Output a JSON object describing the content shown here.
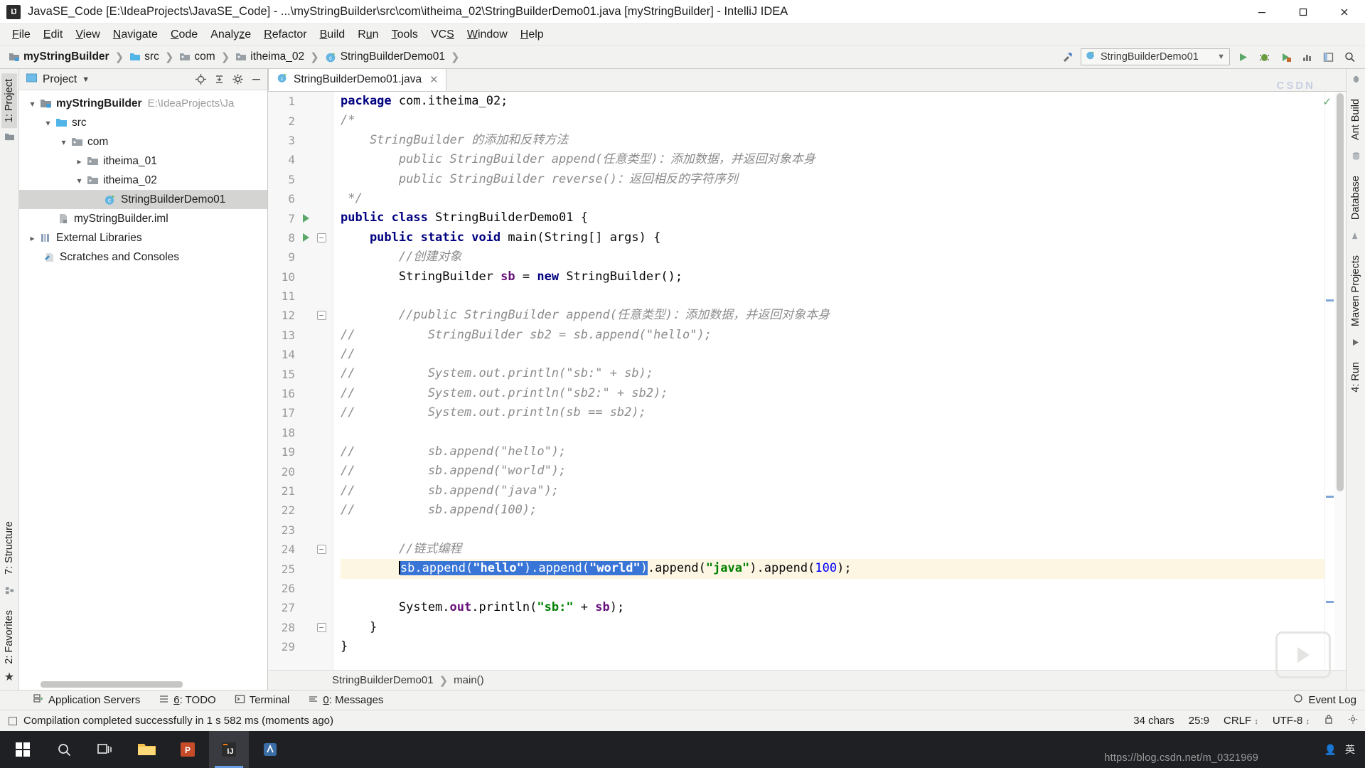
{
  "window": {
    "title": "JavaSE_Code [E:\\IdeaProjects\\JavaSE_Code] - ...\\myStringBuilder\\src\\com\\itheima_02\\StringBuilderDemo01.java [myStringBuilder] - IntelliJ IDEA",
    "app_icon": "IJ",
    "controls": {
      "minimize": "minimize-icon",
      "maximize": "maximize-icon",
      "close": "close-icon"
    }
  },
  "menubar": {
    "items": [
      {
        "label": "File",
        "mnemonic": "F"
      },
      {
        "label": "Edit",
        "mnemonic": "E"
      },
      {
        "label": "View",
        "mnemonic": "V"
      },
      {
        "label": "Navigate",
        "mnemonic": "N"
      },
      {
        "label": "Code",
        "mnemonic": "C"
      },
      {
        "label": "Analyze",
        "mnemonic": "z"
      },
      {
        "label": "Refactor",
        "mnemonic": "R"
      },
      {
        "label": "Build",
        "mnemonic": "B"
      },
      {
        "label": "Run",
        "mnemonic": "u"
      },
      {
        "label": "Tools",
        "mnemonic": "T"
      },
      {
        "label": "VCS",
        "mnemonic": "S"
      },
      {
        "label": "Window",
        "mnemonic": "W"
      },
      {
        "label": "Help",
        "mnemonic": "H"
      }
    ]
  },
  "navbar": {
    "breadcrumbs": [
      {
        "label": "myStringBuilder",
        "icon": "module-icon",
        "bold": true
      },
      {
        "label": "src",
        "icon": "source-folder-icon",
        "bold": false
      },
      {
        "label": "com",
        "icon": "package-icon",
        "bold": false
      },
      {
        "label": "itheima_02",
        "icon": "package-icon",
        "bold": false
      },
      {
        "label": "StringBuilderDemo01",
        "icon": "java-class-icon",
        "bold": false
      }
    ],
    "separator": "›",
    "run_config": "StringBuilderDemo01",
    "actions": [
      "hammer-build-icon",
      "run-icon",
      "debug-icon",
      "coverage-icon",
      "profile-icon",
      "layout-icon",
      "search-icon"
    ]
  },
  "left_strip": {
    "tabs": [
      {
        "label": "1: Project",
        "active": true
      },
      {
        "label": "7: Structure",
        "active": false
      },
      {
        "label": "2: Favorites",
        "active": false
      }
    ],
    "bottom_icon": "favorites-star-icon"
  },
  "right_strip": {
    "tabs": [
      {
        "label": "Ant Build"
      },
      {
        "label": "Database"
      },
      {
        "label": "Maven Projects"
      },
      {
        "label": "4: Run"
      }
    ]
  },
  "project_panel": {
    "title": "Project",
    "dropdown": "chevron-down-icon",
    "actions": [
      "locate-icon",
      "collapse-all-icon",
      "settings-gear-icon",
      "hide-icon"
    ],
    "tree": [
      {
        "depth": 0,
        "arrow": "down",
        "icon": "module-icon",
        "label": "myStringBuilder",
        "bold": true,
        "sub": "E:\\IdeaProjects\\Ja",
        "selected": false
      },
      {
        "depth": 1,
        "arrow": "down",
        "icon": "source-folder-icon",
        "label": "src",
        "bold": false,
        "sub": "",
        "selected": false
      },
      {
        "depth": 2,
        "arrow": "down",
        "icon": "package-icon",
        "label": "com",
        "bold": false,
        "sub": "",
        "selected": false
      },
      {
        "depth": 3,
        "arrow": "right",
        "icon": "package-icon",
        "label": "itheima_01",
        "bold": false,
        "sub": "",
        "selected": false
      },
      {
        "depth": 3,
        "arrow": "down",
        "icon": "package-icon",
        "label": "itheima_02",
        "bold": false,
        "sub": "",
        "selected": false
      },
      {
        "depth": 4,
        "arrow": "none",
        "icon": "java-class-icon",
        "label": "StringBuilderDemo01",
        "bold": false,
        "sub": "",
        "selected": true
      },
      {
        "depth": 1,
        "arrow": "none",
        "icon": "iml-file-icon",
        "label": "myStringBuilder.iml",
        "bold": false,
        "sub": "",
        "selected": false
      },
      {
        "depth": 0,
        "arrow": "right",
        "icon": "libraries-icon",
        "label": "External Libraries",
        "bold": false,
        "sub": "",
        "selected": false
      },
      {
        "depth": 0,
        "arrow": "none",
        "icon": "scratches-icon",
        "label": "Scratches and Consoles",
        "bold": false,
        "sub": "",
        "selected": false
      }
    ]
  },
  "editor": {
    "tab": {
      "label": "StringBuilderDemo01.java",
      "icon": "java-class-icon",
      "close": "close-icon"
    },
    "inspection_status": "check-icon",
    "breadcrumbs": [
      "StringBuilderDemo01",
      "main()"
    ],
    "breadcrumb_sep": "›",
    "lines": [
      {
        "n": 1,
        "gutter": "",
        "fold": "",
        "tokens": [
          {
            "t": "package ",
            "c": "kw"
          },
          {
            "t": "com.itheima_02;",
            "c": ""
          }
        ]
      },
      {
        "n": 2,
        "gutter": "",
        "fold": "",
        "tokens": [
          {
            "t": "/*",
            "c": "cmt"
          }
        ]
      },
      {
        "n": 3,
        "gutter": "",
        "fold": "",
        "tokens": [
          {
            "t": "    StringBuilder 的添加和反转方法",
            "c": "cmt"
          }
        ]
      },
      {
        "n": 4,
        "gutter": "",
        "fold": "",
        "tokens": [
          {
            "t": "        public StringBuilder append(任意类型)：添加数据，并返回对象本身",
            "c": "cmt"
          }
        ]
      },
      {
        "n": 5,
        "gutter": "",
        "fold": "",
        "tokens": [
          {
            "t": "        public StringBuilder reverse()：返回相反的字符序列",
            "c": "cmt"
          }
        ]
      },
      {
        "n": 6,
        "gutter": "",
        "fold": "",
        "tokens": [
          {
            "t": " */",
            "c": "cmt"
          }
        ]
      },
      {
        "n": 7,
        "gutter": "run",
        "fold": "",
        "tokens": [
          {
            "t": "public class ",
            "c": "kw"
          },
          {
            "t": "StringBuilderDemo01 {",
            "c": ""
          }
        ]
      },
      {
        "n": 8,
        "gutter": "run",
        "fold": "minus",
        "tokens": [
          {
            "t": "    public static void ",
            "c": "kw"
          },
          {
            "t": "main(String[] args) {",
            "c": ""
          }
        ]
      },
      {
        "n": 9,
        "gutter": "",
        "fold": "",
        "tokens": [
          {
            "t": "        ",
            "c": ""
          },
          {
            "t": "//创建对象",
            "c": "cmt"
          }
        ]
      },
      {
        "n": 10,
        "gutter": "",
        "fold": "",
        "tokens": [
          {
            "t": "        StringBuilder ",
            "c": ""
          },
          {
            "t": "sb",
            "c": "fld"
          },
          {
            "t": " = ",
            "c": ""
          },
          {
            "t": "new ",
            "c": "kw"
          },
          {
            "t": "StringBuilder();",
            "c": ""
          }
        ]
      },
      {
        "n": 11,
        "gutter": "",
        "fold": "",
        "tokens": []
      },
      {
        "n": 12,
        "gutter": "",
        "fold": "minus",
        "tokens": [
          {
            "t": "        ",
            "c": ""
          },
          {
            "t": "//public StringBuilder append(任意类型)：添加数据，并返回对象本身",
            "c": "cmt"
          }
        ]
      },
      {
        "n": 13,
        "gutter": "",
        "fold": "",
        "tokens": [
          {
            "t": "//          StringBuilder sb2 = sb.append(\"hello\");",
            "c": "cmt"
          }
        ]
      },
      {
        "n": 14,
        "gutter": "",
        "fold": "",
        "tokens": [
          {
            "t": "//",
            "c": "cmt"
          }
        ]
      },
      {
        "n": 15,
        "gutter": "",
        "fold": "",
        "tokens": [
          {
            "t": "//          System.out.println(\"sb:\" + sb);",
            "c": "cmt"
          }
        ]
      },
      {
        "n": 16,
        "gutter": "",
        "fold": "",
        "tokens": [
          {
            "t": "//          System.out.println(\"sb2:\" + sb2);",
            "c": "cmt"
          }
        ]
      },
      {
        "n": 17,
        "gutter": "",
        "fold": "",
        "tokens": [
          {
            "t": "//          System.out.println(sb == sb2);",
            "c": "cmt"
          }
        ]
      },
      {
        "n": 18,
        "gutter": "",
        "fold": "",
        "tokens": []
      },
      {
        "n": 19,
        "gutter": "",
        "fold": "",
        "tokens": [
          {
            "t": "//          sb.append(\"hello\");",
            "c": "cmt"
          }
        ]
      },
      {
        "n": 20,
        "gutter": "",
        "fold": "",
        "tokens": [
          {
            "t": "//          sb.append(\"world\");",
            "c": "cmt"
          }
        ]
      },
      {
        "n": 21,
        "gutter": "",
        "fold": "",
        "tokens": [
          {
            "t": "//          sb.append(\"java\");",
            "c": "cmt"
          }
        ]
      },
      {
        "n": 22,
        "gutter": "",
        "fold": "",
        "tokens": [
          {
            "t": "//          sb.append(100);",
            "c": "cmt"
          }
        ]
      },
      {
        "n": 23,
        "gutter": "",
        "fold": "",
        "tokens": []
      },
      {
        "n": 24,
        "gutter": "",
        "fold": "minus",
        "tokens": [
          {
            "t": "        ",
            "c": ""
          },
          {
            "t": "//链式编程",
            "c": "cmt"
          }
        ]
      },
      {
        "n": 25,
        "gutter": "",
        "fold": "",
        "highlight": true,
        "tokens": [
          {
            "t": "        ",
            "c": ""
          },
          {
            "t": "caret",
            "c": "caret"
          },
          {
            "t": "sb.append(",
            "c": "sel"
          },
          {
            "t": "\"hello\"",
            "c": "sel-str"
          },
          {
            "t": ").append(",
            "c": "sel"
          },
          {
            "t": "\"world\"",
            "c": "sel-str"
          },
          {
            "t": ")",
            "c": "sel"
          },
          {
            "t": ".append(",
            "c": ""
          },
          {
            "t": "\"java\"",
            "c": "str"
          },
          {
            "t": ").append(",
            "c": ""
          },
          {
            "t": "100",
            "c": "num"
          },
          {
            "t": ");",
            "c": ""
          }
        ]
      },
      {
        "n": 26,
        "gutter": "",
        "fold": "",
        "tokens": []
      },
      {
        "n": 27,
        "gutter": "",
        "fold": "",
        "tokens": [
          {
            "t": "        System.",
            "c": ""
          },
          {
            "t": "out",
            "c": "fld"
          },
          {
            "t": ".println(",
            "c": ""
          },
          {
            "t": "\"sb:\"",
            "c": "str"
          },
          {
            "t": " + ",
            "c": ""
          },
          {
            "t": "sb",
            "c": "fld"
          },
          {
            "t": ");",
            "c": ""
          }
        ]
      },
      {
        "n": 28,
        "gutter": "",
        "fold": "minus",
        "tokens": [
          {
            "t": "    }",
            "c": ""
          }
        ]
      },
      {
        "n": 29,
        "gutter": "",
        "fold": "",
        "tokens": [
          {
            "t": "}",
            "c": ""
          }
        ]
      }
    ]
  },
  "tool_window_bar": {
    "items": [
      {
        "label": "Application Servers",
        "icon": "servers-icon",
        "mnemonic": ""
      },
      {
        "label": "6: TODO",
        "icon": "todo-icon",
        "mnemonic": "6"
      },
      {
        "label": "Terminal",
        "icon": "terminal-icon",
        "mnemonic": ""
      },
      {
        "label": "0: Messages",
        "icon": "messages-icon",
        "mnemonic": "0"
      }
    ],
    "event_log": {
      "label": "Event Log",
      "icon": "event-log-icon"
    }
  },
  "statusbar": {
    "message": "Compilation completed successfully in 1 s 582 ms (moments ago)",
    "chars": "34 chars",
    "caret_position": "25:9",
    "line_separator": "CRLF",
    "encoding": "UTF-8",
    "lock_icon": "lock-icon",
    "selectors": "chevron-updown-icon"
  },
  "taskbar": {
    "items": [
      {
        "name": "start-button",
        "icon": "windows-logo-icon",
        "active": false
      },
      {
        "name": "search-button",
        "icon": "search-icon",
        "active": false
      },
      {
        "name": "task-view-button",
        "icon": "task-view-icon",
        "active": false
      },
      {
        "name": "file-explorer-button",
        "icon": "folder-icon",
        "active": false
      },
      {
        "name": "powerpoint-button",
        "icon": "powerpoint-icon",
        "active": false
      },
      {
        "name": "intellij-button",
        "icon": "intellij-icon",
        "active": true
      },
      {
        "name": "app-button",
        "icon": "blue-app-icon",
        "active": false
      }
    ]
  },
  "watermark": "https://blog.csdn.net/m_0321969",
  "overlay_logo": "CSDN"
}
